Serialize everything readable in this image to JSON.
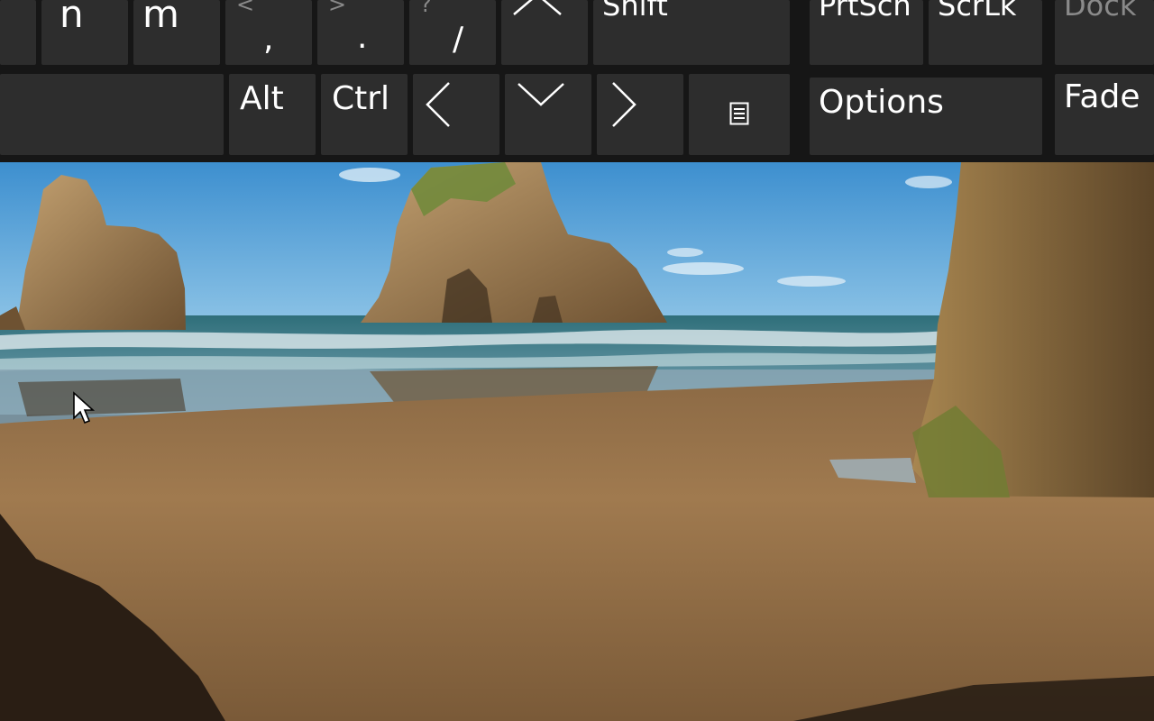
{
  "keyboard": {
    "row1": {
      "n": "n",
      "m": "m",
      "comma_shift": "<",
      "comma": ",",
      "period_shift": ">",
      "period": ".",
      "slash_shift": "?",
      "slash": "/",
      "shift": "Shift",
      "prtscn": "PrtScn",
      "scrlk": "ScrLk",
      "dock": "Dock"
    },
    "row2": {
      "alt": "Alt",
      "ctrl": "Ctrl",
      "options": "Options",
      "fade": "Fade"
    },
    "icons": {
      "up": "chevron-up-icon",
      "left": "chevron-left-icon",
      "down": "chevron-down-icon",
      "right": "chevron-right-icon",
      "menu": "context-menu-icon"
    },
    "colors": {
      "key": "#2d2d2d",
      "key_text": "#ffffff",
      "dim_text": "#8a8a8a",
      "background": "#161616"
    }
  },
  "wallpaper": {
    "subject": "beach-with-sea-stacks"
  }
}
